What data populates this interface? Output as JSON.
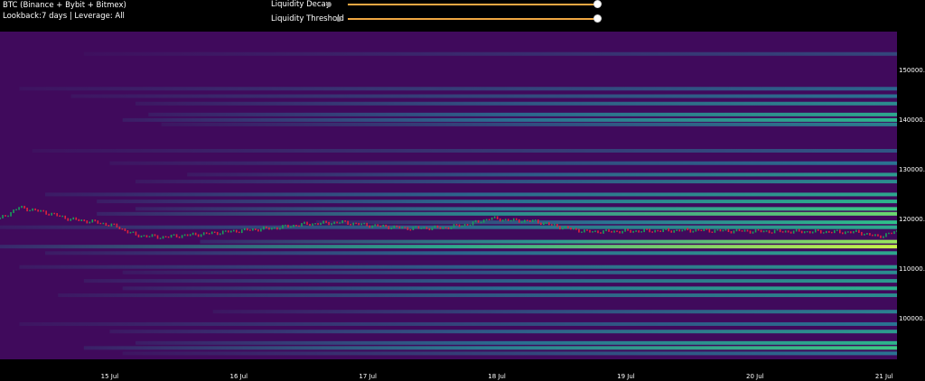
{
  "header": {
    "title": "BTC (Binance + Bybit + Bitmex)",
    "subtitle": "Lookback:7 days | Leverage: All"
  },
  "controls": [
    {
      "label": "Liquidity Decay",
      "value": 1.0
    },
    {
      "label": "Liquidity Threshold",
      "value": 1.0
    }
  ],
  "colors": {
    "background": "#000000",
    "heat_low": "#400a5c",
    "heat_mid": "#2a6f92",
    "heat_high": "#2ec68a",
    "heat_peak": "#c7f24a",
    "candle_up": "#18a05a",
    "candle_down": "#e0223c",
    "slider_track": "#f0a742"
  },
  "chart_data": {
    "type": "heatmap",
    "title": "BTC (Binance + Bybit + Bitmex)",
    "x_labels": [
      "15 Jul",
      "16 Jul",
      "17 Jul",
      "18 Jul",
      "19 Jul",
      "20 Jul",
      "21 Jul"
    ],
    "y_ticks": [
      "100000.0",
      "110000.0",
      "120000.0",
      "130000.0",
      "140000.0",
      "150000.0"
    ],
    "y_range": [
      92000,
      158000
    ],
    "x_range_days": [
      14.15,
      21.1
    ],
    "x_tick_days": [
      15,
      16,
      17,
      18,
      19,
      20,
      21
    ],
    "price_path": [
      {
        "day": 14.15,
        "price": 120300
      },
      {
        "day": 14.3,
        "price": 122600
      },
      {
        "day": 14.5,
        "price": 121600
      },
      {
        "day": 14.7,
        "price": 120200
      },
      {
        "day": 14.9,
        "price": 119600
      },
      {
        "day": 15.05,
        "price": 118800
      },
      {
        "day": 15.2,
        "price": 117000
      },
      {
        "day": 15.4,
        "price": 116600
      },
      {
        "day": 15.55,
        "price": 116900
      },
      {
        "day": 15.75,
        "price": 117300
      },
      {
        "day": 16.0,
        "price": 117900
      },
      {
        "day": 16.3,
        "price": 118500
      },
      {
        "day": 16.5,
        "price": 119200
      },
      {
        "day": 16.8,
        "price": 119600
      },
      {
        "day": 17.0,
        "price": 119000
      },
      {
        "day": 17.3,
        "price": 118400
      },
      {
        "day": 17.6,
        "price": 118500
      },
      {
        "day": 17.8,
        "price": 119300
      },
      {
        "day": 17.95,
        "price": 120400
      },
      {
        "day": 18.1,
        "price": 120000
      },
      {
        "day": 18.3,
        "price": 119800
      },
      {
        "day": 18.5,
        "price": 118600
      },
      {
        "day": 18.7,
        "price": 117700
      },
      {
        "day": 19.0,
        "price": 117800
      },
      {
        "day": 19.5,
        "price": 118000
      },
      {
        "day": 20.0,
        "price": 117800
      },
      {
        "day": 20.5,
        "price": 117700
      },
      {
        "day": 20.8,
        "price": 117600
      },
      {
        "day": 20.95,
        "price": 116700
      },
      {
        "day": 21.1,
        "price": 117700
      }
    ],
    "liquidity_bands": [
      {
        "price": 153500,
        "start_day": 14.8,
        "intensity": 0.2
      },
      {
        "price": 146500,
        "start_day": 14.3,
        "intensity": 0.3
      },
      {
        "price": 145000,
        "start_day": 14.7,
        "intensity": 0.35
      },
      {
        "price": 143500,
        "start_day": 15.2,
        "intensity": 0.45
      },
      {
        "price": 141300,
        "start_day": 15.3,
        "intensity": 0.55
      },
      {
        "price": 140200,
        "start_day": 15.1,
        "intensity": 0.6
      },
      {
        "price": 139300,
        "start_day": 15.4,
        "intensity": 0.4
      },
      {
        "price": 134000,
        "start_day": 14.4,
        "intensity": 0.25
      },
      {
        "price": 131500,
        "start_day": 15.0,
        "intensity": 0.35
      },
      {
        "price": 129200,
        "start_day": 15.6,
        "intensity": 0.5
      },
      {
        "price": 127800,
        "start_day": 15.2,
        "intensity": 0.45
      },
      {
        "price": 125200,
        "start_day": 14.5,
        "intensity": 0.55
      },
      {
        "price": 123800,
        "start_day": 14.9,
        "intensity": 0.6
      },
      {
        "price": 122300,
        "start_day": 15.2,
        "intensity": 0.7
      },
      {
        "price": 121300,
        "start_day": 14.9,
        "intensity": 0.8
      },
      {
        "price": 119600,
        "start_day": 16.6,
        "intensity": 0.65
      },
      {
        "price": 118600,
        "start_day": 14.15,
        "intensity": 0.55
      },
      {
        "price": 115700,
        "start_day": 15.7,
        "intensity": 0.9
      },
      {
        "price": 114700,
        "start_day": 14.15,
        "intensity": 1.0
      },
      {
        "price": 113400,
        "start_day": 14.5,
        "intensity": 0.55
      },
      {
        "price": 110600,
        "start_day": 14.3,
        "intensity": 0.5
      },
      {
        "price": 109500,
        "start_day": 15.1,
        "intensity": 0.45
      },
      {
        "price": 107800,
        "start_day": 14.8,
        "intensity": 0.5
      },
      {
        "price": 106300,
        "start_day": 15.1,
        "intensity": 0.6
      },
      {
        "price": 104900,
        "start_day": 14.6,
        "intensity": 0.45
      },
      {
        "price": 101600,
        "start_day": 15.8,
        "intensity": 0.4
      },
      {
        "price": 99100,
        "start_day": 14.3,
        "intensity": 0.35
      },
      {
        "price": 97600,
        "start_day": 15.0,
        "intensity": 0.5
      },
      {
        "price": 95300,
        "start_day": 15.2,
        "intensity": 0.6
      },
      {
        "price": 94300,
        "start_day": 14.8,
        "intensity": 0.7
      },
      {
        "price": 93200,
        "start_day": 15.1,
        "intensity": 0.35
      }
    ]
  }
}
